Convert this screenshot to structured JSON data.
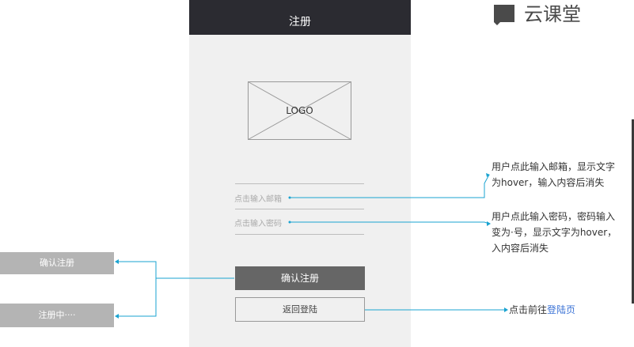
{
  "phone": {
    "title": "注册",
    "logo_text": "LOGO",
    "email_placeholder": "点击输入邮箱",
    "password_placeholder": "点击输入密码",
    "confirm_label": "确认注册",
    "back_label": "返回登陆"
  },
  "states": {
    "confirm_label": "确认注册",
    "registering_label": "注册中····"
  },
  "notes": {
    "email_line1": "用户点此输入邮箱，显示文字",
    "email_line2": "为hover，输入内容后消失",
    "password_line1": "用户点此输入密码，密码输入",
    "password_line2": "变为·号，显示文字为hover，",
    "password_line3": "入内容后消失",
    "login_prefix": "点击前往",
    "login_link": "登陆页"
  },
  "brand": {
    "name": "云课堂",
    "icon": "book-icon"
  },
  "colors": {
    "header": "#2b2b31",
    "phone_bg": "#f0f0f0",
    "connector": "#1aa3d1",
    "link": "#3b73d6",
    "state_button": "#b4b4b4",
    "primary_button": "#666666"
  }
}
